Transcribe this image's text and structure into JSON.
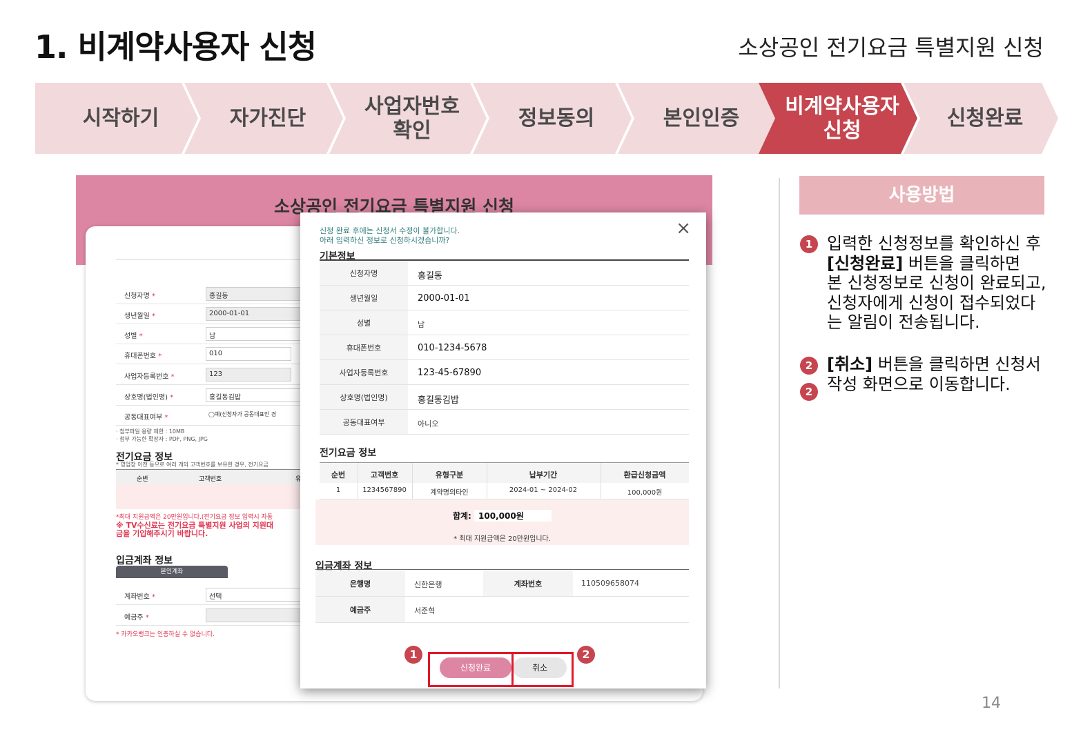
{
  "page": {
    "title": "1. 비계약사용자 신청",
    "subtitle": "소상공인 전기요금 특별지원 신청",
    "page_number": "14"
  },
  "steps": [
    {
      "label": "시작하기",
      "active": false
    },
    {
      "label": "자가진단",
      "active": false
    },
    {
      "label": "사업자번호\n확인",
      "active": false
    },
    {
      "label": "정보동의",
      "active": false
    },
    {
      "label": "본인인증",
      "active": false
    },
    {
      "label": "비계약사용자\n신청",
      "active": true
    },
    {
      "label": "신청완료",
      "active": false
    }
  ],
  "background_form": {
    "header_title": "소상공인 전기요금 특별지원 신청",
    "required_mark": "*",
    "rows": [
      {
        "label": "신청자명",
        "value": "홍길동"
      },
      {
        "label": "생년월일",
        "value": "2000-01-01"
      },
      {
        "label": "성별",
        "value": "남"
      },
      {
        "label": "휴대폰번호",
        "value": "010"
      },
      {
        "label": "사업자등록번호",
        "value": "123"
      },
      {
        "label": "상호명(법인명)",
        "value": "홍길동김밥"
      },
      {
        "label": "공동대표여부",
        "value": "◯예(신청자가 공동대표인 경"
      }
    ],
    "file_note_1": "· 첨부파일 용량 제한 : 10MB",
    "file_note_2": "· 첨부 가능한 확장자 : PDF, PNG, JPG",
    "bill_section_title": "전기요금 정보",
    "bill_section_note": "* 영업장 이전 등으로 여러 개의 고객번호를 보유한 경우, 전기요금",
    "bill_col_1": "순번",
    "bill_col_2": "고객번호",
    "bill_col_3": "유",
    "red_note_1": "*최대 지원금액은 20만원입니다.(전기요금 정보 입력시 자동",
    "red_note_2": "※ TV수신료는 전기요금 특별지원 사업의 지원대",
    "red_note_3": "금을 기입해주시기 바랍니다.",
    "account_section_title": "입금계좌 정보",
    "account_tab": "본인계좌",
    "account_rows": [
      {
        "label": "계좌번호",
        "value": "선택"
      },
      {
        "label": "예금주",
        "value": ""
      }
    ],
    "kakao_note": "* 카카오뱅크는 인증하실 수 없습니다."
  },
  "modal": {
    "notice_line_1": "신청 완료 후에는 신청서 수정이 불가합니다.",
    "notice_line_2": "아래 입력하신 정보로 신청하시겠습니까?",
    "basic_title": "기본정보",
    "basic_rows": [
      {
        "label": "신청자명",
        "value": "홍길동"
      },
      {
        "label": "생년월일",
        "value": "2000-01-01"
      },
      {
        "label": "성별",
        "value": "남"
      },
      {
        "label": "휴대폰번호",
        "value": "010-1234-5678"
      },
      {
        "label": "사업자등록번호",
        "value": "123-45-67890"
      },
      {
        "label": "상호명(법인명)",
        "value": "홍길동김밥"
      },
      {
        "label": "공동대표여부",
        "value": "아니오"
      }
    ],
    "bill_title": "전기요금 정보",
    "bill_headers": [
      "순번",
      "고객번호",
      "유형구분",
      "납부기간",
      "환급신청금액"
    ],
    "bill_rows": [
      [
        "1",
        "1234567890",
        "계약명의타인",
        "2024-01 ~ 2024-02",
        "100,000원"
      ]
    ],
    "total_label": "합계:",
    "total_value": "100,000원",
    "max_note": "* 최대 지원금액은 20만원입니다.",
    "account_title": "입금계좌 정보",
    "bank_label": "은행명",
    "bank_value": "신한은행",
    "account_no_label": "계좌번호",
    "account_no_value": "110509658074",
    "holder_label": "예금주",
    "holder_value": "서준혁",
    "confirm_button": "신청완료",
    "cancel_button": "취소",
    "badge_1": "1",
    "badge_2": "2",
    "close_icon": "×"
  },
  "howto": {
    "title": "사용방법",
    "badge_1": "1",
    "badge_2": "2",
    "step1_bold": "[신청완료]",
    "step1_line1": "입력한 신청정보를 확인하신 후",
    "step1_line2_rest": " 버튼을 클릭하면",
    "step1_line3": "본 신청정보로 신청이 완료되고,",
    "step1_line4": "신청자에게 신청이 접수되었다",
    "step1_line5": "는 알림이 전송됩니다.",
    "step2_bold": "[취소]",
    "step2_line1_rest": " 버튼을 클릭하면 신청서",
    "step2_line2": "작성 화면으로 이동합니다."
  },
  "colors": {
    "accent": "#c6454f",
    "step_inactive": "#f2d9dc",
    "pink_header": "#dd86a3",
    "highlight_box": "#e0192b"
  }
}
